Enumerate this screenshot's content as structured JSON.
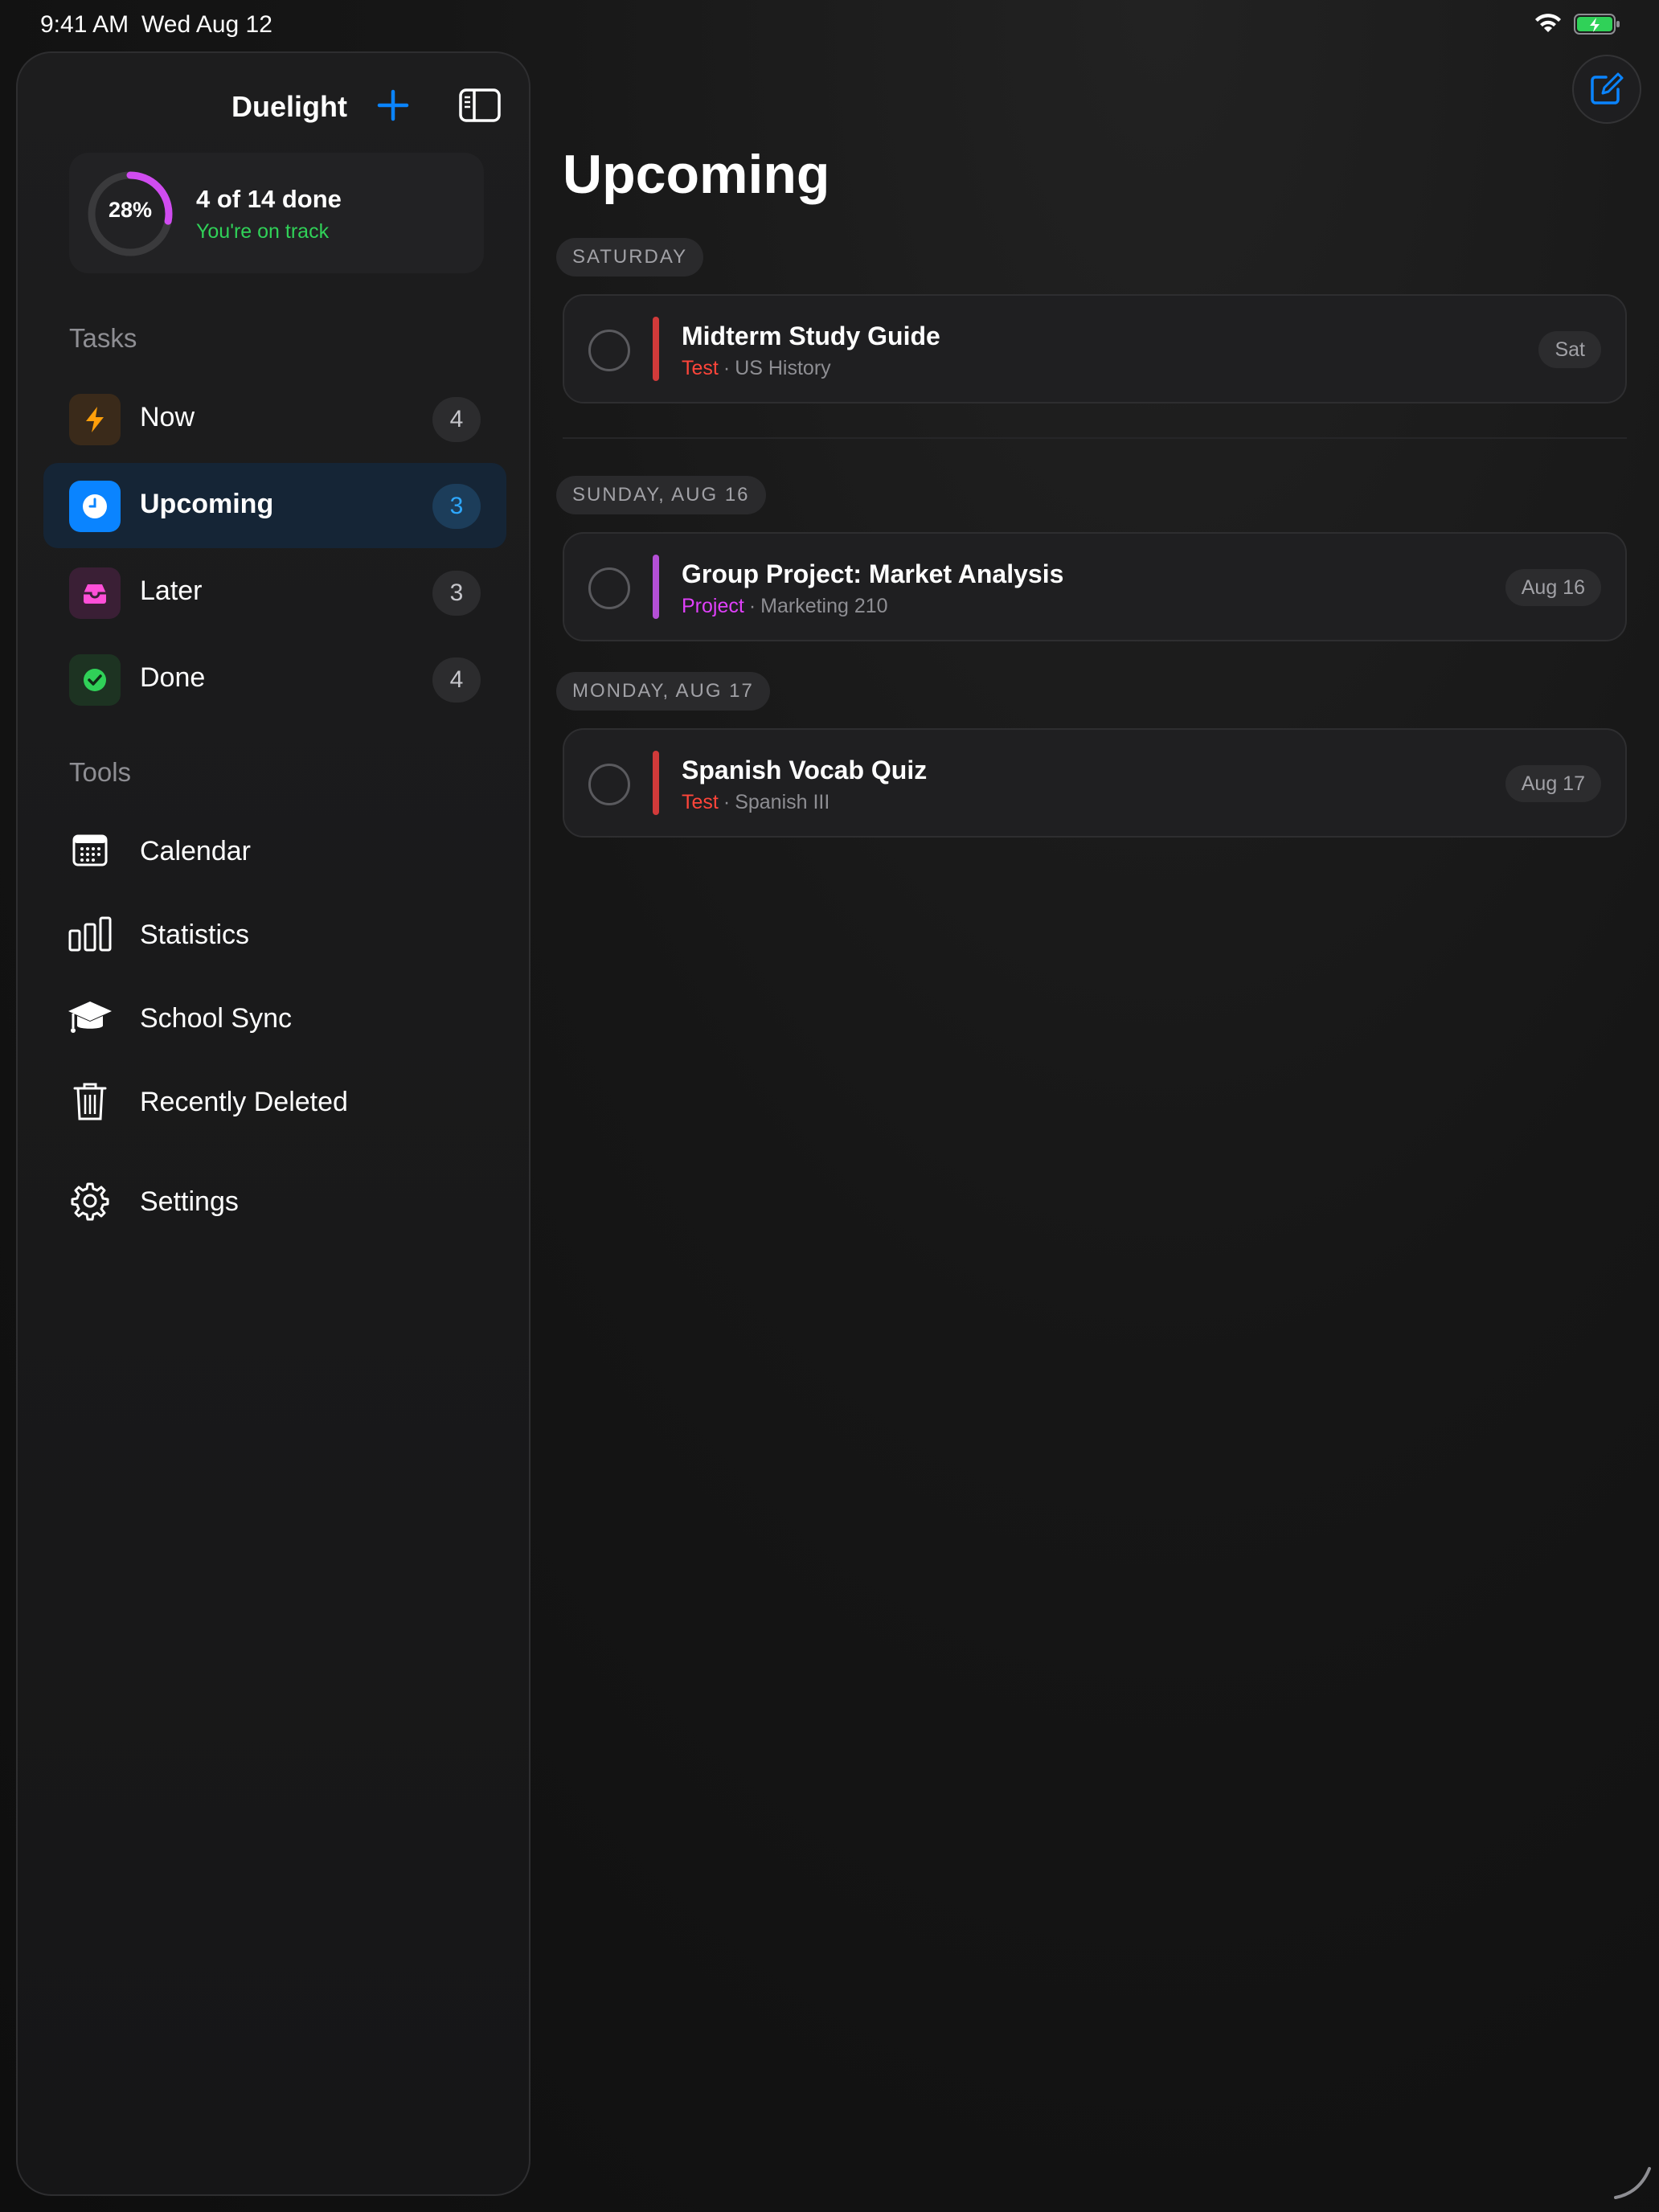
{
  "status_bar": {
    "time": "9:41 AM",
    "date": "Wed Aug 12"
  },
  "sidebar": {
    "app_title": "Duelight",
    "progress": {
      "percent_label": "28%",
      "fraction": 0.28,
      "title": "4 of 14 done",
      "subtitle": "You're on track"
    },
    "tasks_label": "Tasks",
    "nav": [
      {
        "label": "Now",
        "count": "4",
        "icon": "bolt-icon",
        "color": "#ff9f0a",
        "bg": "#3a2a1a"
      },
      {
        "label": "Upcoming",
        "count": "3",
        "icon": "clock-icon",
        "color": "#ffffff",
        "bg": "#0a84ff",
        "active": true
      },
      {
        "label": "Later",
        "count": "3",
        "icon": "tray-icon",
        "color": "#ff4fd8",
        "bg": "#3a1f35"
      },
      {
        "label": "Done",
        "count": "4",
        "icon": "checkmark-icon",
        "color": "#30d158",
        "bg": "#1d3322"
      }
    ],
    "tools_label": "Tools",
    "tools": [
      {
        "label": "Calendar",
        "icon": "calendar-icon"
      },
      {
        "label": "Statistics",
        "icon": "bar-chart-icon"
      },
      {
        "label": "School Sync",
        "icon": "graduation-cap-icon"
      },
      {
        "label": "Recently Deleted",
        "icon": "trash-icon"
      }
    ],
    "settings_label": "Settings"
  },
  "main": {
    "title": "Upcoming",
    "groups": [
      {
        "day": "SATURDAY",
        "tasks": [
          {
            "title": "Midterm Study Guide",
            "type": "Test",
            "course": "US History",
            "date": "Sat",
            "accent": "#ff453a"
          }
        ]
      },
      {
        "day": "SUNDAY, AUG 16",
        "tasks": [
          {
            "title": "Group Project: Market Analysis",
            "type": "Project",
            "course": "Marketing 210",
            "date": "Aug 16",
            "accent": "#bf5af2"
          }
        ]
      },
      {
        "day": "MONDAY, AUG 17",
        "tasks": [
          {
            "title": "Spanish Vocab Quiz",
            "type": "Test",
            "course": "Spanish III",
            "date": "Aug 17",
            "accent": "#ff453a"
          }
        ]
      }
    ]
  },
  "colors": {
    "accent_blue": "#0a84ff",
    "progress_ring": "#d04cf0",
    "on_track_green": "#30d158",
    "test_red": "#ff453a",
    "project_pink": "#e040fb"
  }
}
